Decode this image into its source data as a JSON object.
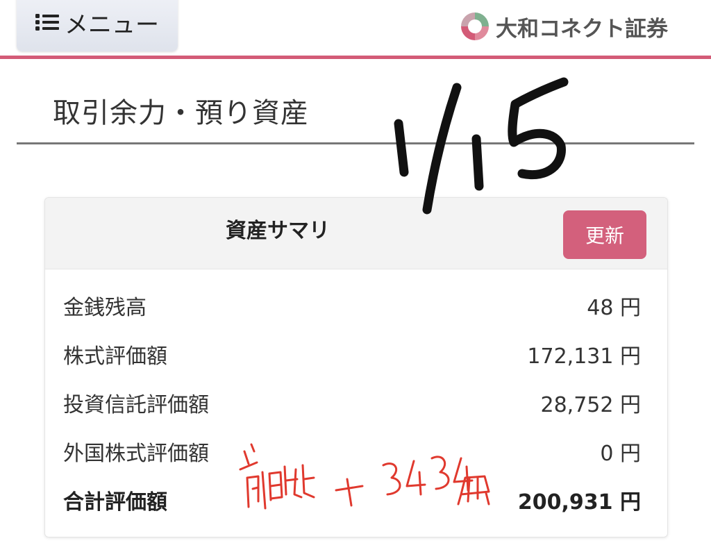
{
  "header": {
    "menu_label": "メニュー",
    "menu_icon": "list-icon",
    "logo_text": "大和コネクト証券",
    "accent_color": "#d35b77"
  },
  "page": {
    "title": "取引余力・預り資産"
  },
  "summary": {
    "title": "資産サマリ",
    "refresh_label": "更新",
    "refresh_color": "#d3607c",
    "rows": [
      {
        "label": "金銭残高",
        "value": "48 円"
      },
      {
        "label": "株式評価額",
        "value": "172,131 円"
      },
      {
        "label": "投資信託評価額",
        "value": "28,752 円"
      },
      {
        "label": "外国株式評価額",
        "value": "0 円"
      },
      {
        "label": "合計評価額",
        "value": "200,931 円"
      }
    ]
  },
  "annotations": {
    "date_note": "1/15",
    "diff_note": "前日比 +3434円"
  }
}
